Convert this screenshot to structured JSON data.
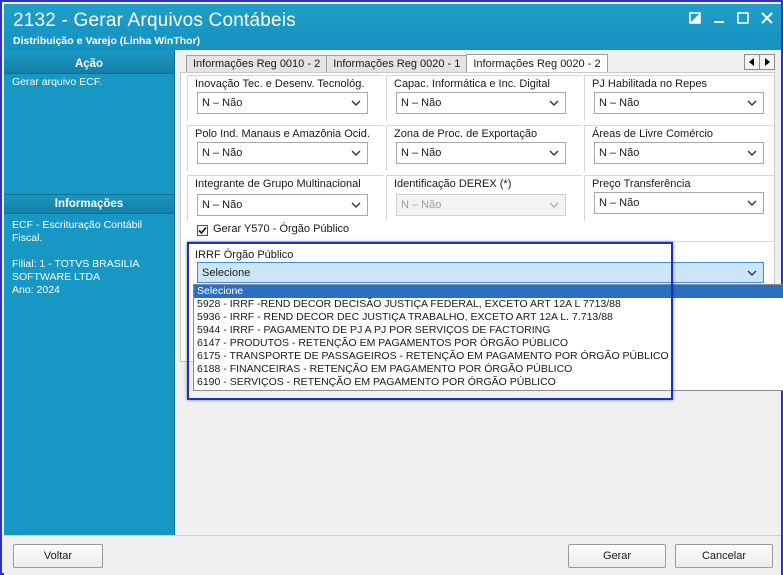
{
  "window": {
    "title": "2132 - Gerar Arquivos Contábeis",
    "subtitle": "Distribuição e Varejo (Linha WinThor)"
  },
  "sidebar": {
    "acao_header": "Ação",
    "acao_text": "Gerar arquivo ECF.",
    "info_header": "Informações",
    "info_text": "ECF - Escrituração Contábil Fiscal.\n\nFilial: 1 - TOTVS BRASILIA SOFTWARE LTDA\nAno: 2024"
  },
  "tabs": [
    {
      "label": "Informações Reg 0010 - 2",
      "active": false
    },
    {
      "label": "Informações Reg 0020 - 1",
      "active": false
    },
    {
      "label": "Informações Reg 0020 - 2",
      "active": true
    }
  ],
  "fields": {
    "inovacao": {
      "label": "Inovação Tec. e Desenv. Tecnológ.",
      "value": "N – Não"
    },
    "capac": {
      "label": "Capac. Informática e Inc. Digital",
      "value": "N – Não"
    },
    "pj_repes": {
      "label": "PJ Habilitada no Repes",
      "value": "N – Não"
    },
    "polo": {
      "label": "Polo Ind. Manaus e Amazônia Ocid.",
      "value": "N – Não"
    },
    "zona": {
      "label": "Zona de Proc. de Exportação",
      "value": "N – Não"
    },
    "areas": {
      "label": "Áreas de Livre Comércio",
      "value": "N – Não"
    },
    "integrante": {
      "label": "Integrante de Grupo Multinacional",
      "value": "N – Não"
    },
    "derex": {
      "label": "Identificação DEREX (*)",
      "value": "N – Não"
    },
    "preco": {
      "label": "Preço Transferência",
      "value": "N – Não"
    }
  },
  "gerar_y570": {
    "label": "Gerar Y570 - Órgão Público",
    "checked": true
  },
  "irrf": {
    "label": "IRRF Órgão Público",
    "value": "Selecione",
    "options": [
      "Selecione",
      "5928 - IRRF -REND DECOR DECISÃO JUSTIÇA FEDERAL, EXCETO ART 12A L 7713/88",
      "5936 - IRRF - REND DECOR DEC JUSTIÇA TRABALHO, EXCETO ART 12A L. 7.713/88",
      "5944 - IRRF - PAGAMENTO DE PJ A PJ POR SERVIÇOS DE FACTORING",
      "6147 - PRODUTOS - RETENÇÃO EM PAGAMENTOS POR ÓRGÃO PÚBLICO",
      "6175 - TRANSPORTE DE PASSAGEIROS - RETENÇÃO EM PAGAMENTO POR ÓRGÃO PÚBLICO",
      "6188 - FINANCEIRAS - RETENÇÃO EM PAGAMENTO POR ÓRGÃO PÚBLICO",
      "6190 - SERVIÇOS - RETENÇÃO EM PAGAMENTO POR ÓRGÃO PÚBLICO"
    ]
  },
  "buttons": {
    "voltar": "Voltar",
    "gerar": "Gerar",
    "cancelar": "Cancelar"
  },
  "colors": {
    "accent": "#1697c4",
    "highlight_border": "#1f2fc4",
    "selection": "#2c6fc1"
  }
}
